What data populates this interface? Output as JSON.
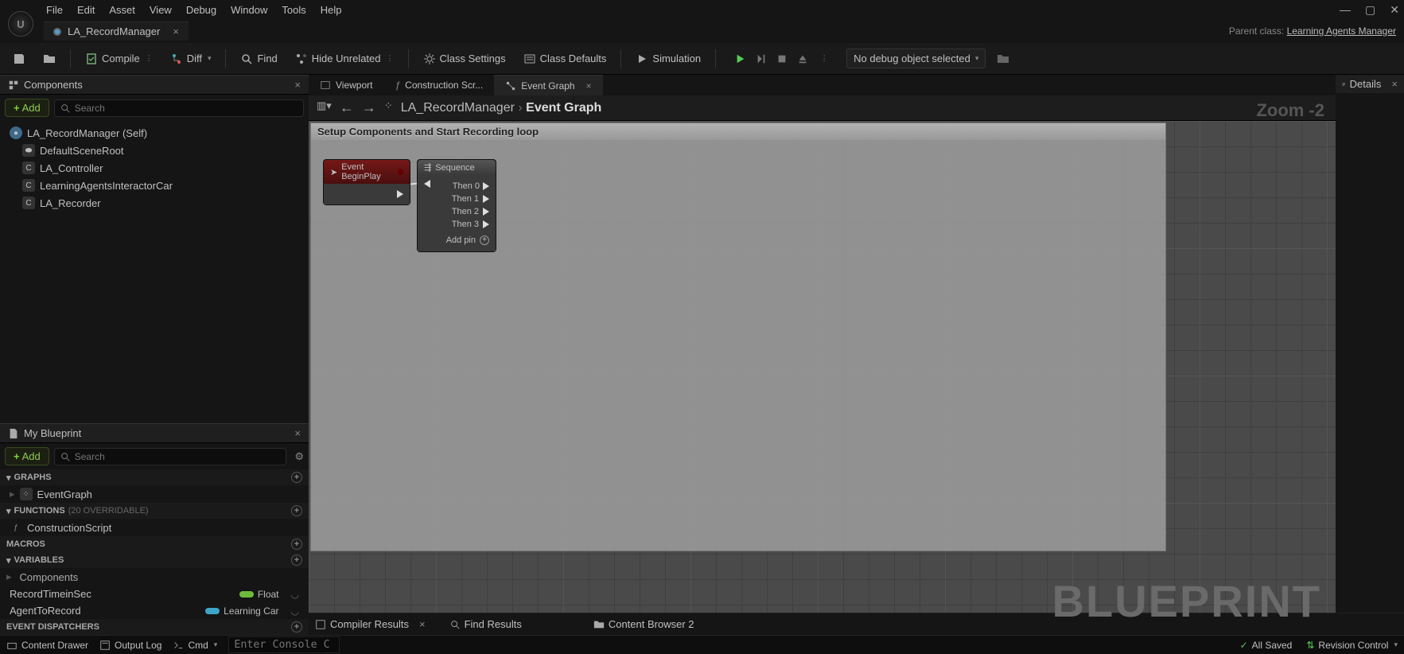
{
  "menubar": [
    "File",
    "Edit",
    "Asset",
    "View",
    "Debug",
    "Window",
    "Tools",
    "Help"
  ],
  "tab": {
    "name": "LA_RecordManager"
  },
  "parentclass": {
    "label": "Parent class:",
    "value": "Learning Agents Manager"
  },
  "toolbar": {
    "compile": "Compile",
    "diff": "Diff",
    "find": "Find",
    "hide": "Hide Unrelated",
    "classset": "Class Settings",
    "classdef": "Class Defaults",
    "sim": "Simulation"
  },
  "debugobj": "No debug object selected",
  "components": {
    "title": "Components",
    "add": "Add",
    "search": "Search",
    "root": "LA_RecordManager (Self)",
    "items": [
      "DefaultSceneRoot",
      "LA_Controller",
      "LearningAgentsInteractorCar",
      "LA_Recorder"
    ]
  },
  "blueprint": {
    "title": "My Blueprint",
    "add": "Add",
    "search": "Search",
    "graphs": "GRAPHS",
    "eventgraph": "EventGraph",
    "functions": "FUNCTIONS",
    "funcnote": "(20 OVERRIDABLE)",
    "constr": "ConstructionScript",
    "macros": "MACROS",
    "variables": "VARIABLES",
    "compcat": "Components",
    "var1": {
      "name": "RecordTimeinSec",
      "type": "Float"
    },
    "var2": {
      "name": "AgentToRecord",
      "type": "Learning Car"
    },
    "evtdisp": "EVENT DISPATCHERS"
  },
  "ctabs": {
    "viewport": "Viewport",
    "constr": "Construction Scr...",
    "eventgraph": "Event Graph"
  },
  "breadcrumb": {
    "root": "LA_RecordManager",
    "leaf": "Event Graph"
  },
  "zoom": "Zoom -2",
  "comment": "Setup Components and Start Recording loop",
  "node1": {
    "title": "Event BeginPlay"
  },
  "node2": {
    "title": "Sequence",
    "pins": [
      "Then 0",
      "Then 1",
      "Then 2",
      "Then 3"
    ],
    "addpin": "Add pin"
  },
  "watermark": "BLUEPRINT",
  "details": "Details",
  "bottomtabs": {
    "compres": "Compiler Results",
    "findres": "Find Results",
    "cbrowser": "Content Browser 2"
  },
  "statusbar": {
    "cdrawer": "Content Drawer",
    "olog": "Output Log",
    "cmd": "Cmd",
    "console": "Enter Console C",
    "saved": "All Saved",
    "rev": "Revision Control"
  }
}
